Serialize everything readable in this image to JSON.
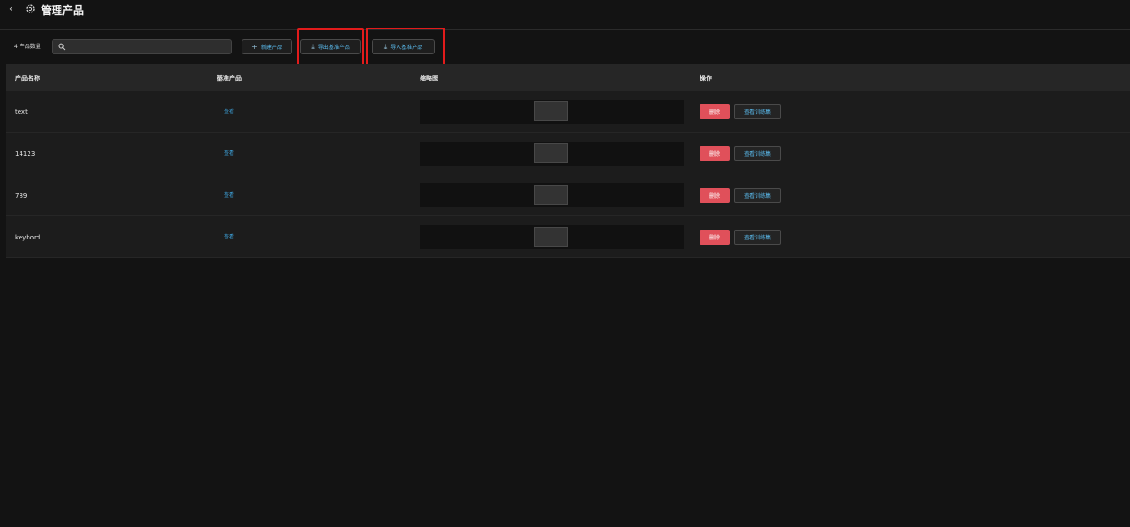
{
  "header": {
    "back_symbol": "‹",
    "title": "管理产品"
  },
  "toolbar": {
    "count_label": "4 产品数量",
    "search_placeholder": "",
    "search_value": "",
    "new_label": "新建产品",
    "export_label": "导出基准产品",
    "import_label": "导入基准产品"
  },
  "table": {
    "columns": [
      "产品名称",
      "基准产品",
      "缩略图",
      "操作"
    ],
    "rows": [
      {
        "name": "text",
        "base": "查看",
        "delete": "删除",
        "train": "查看训练集"
      },
      {
        "name": "14123",
        "base": "查看",
        "delete": "删除",
        "train": "查看训练集"
      },
      {
        "name": "789",
        "base": "查看",
        "delete": "删除",
        "train": "查看训练集"
      },
      {
        "name": "keybord",
        "base": "查看",
        "delete": "删除",
        "train": "查看训练集"
      }
    ]
  },
  "colors": {
    "accent": "#59b7e8",
    "danger": "#e0505a",
    "highlight": "#e21b1b"
  },
  "icons": {
    "back": "chevron-left-icon",
    "settings": "gear-icon",
    "search": "search-icon",
    "new": "plus-icon",
    "export": "download-icon",
    "import": "upload-icon"
  }
}
